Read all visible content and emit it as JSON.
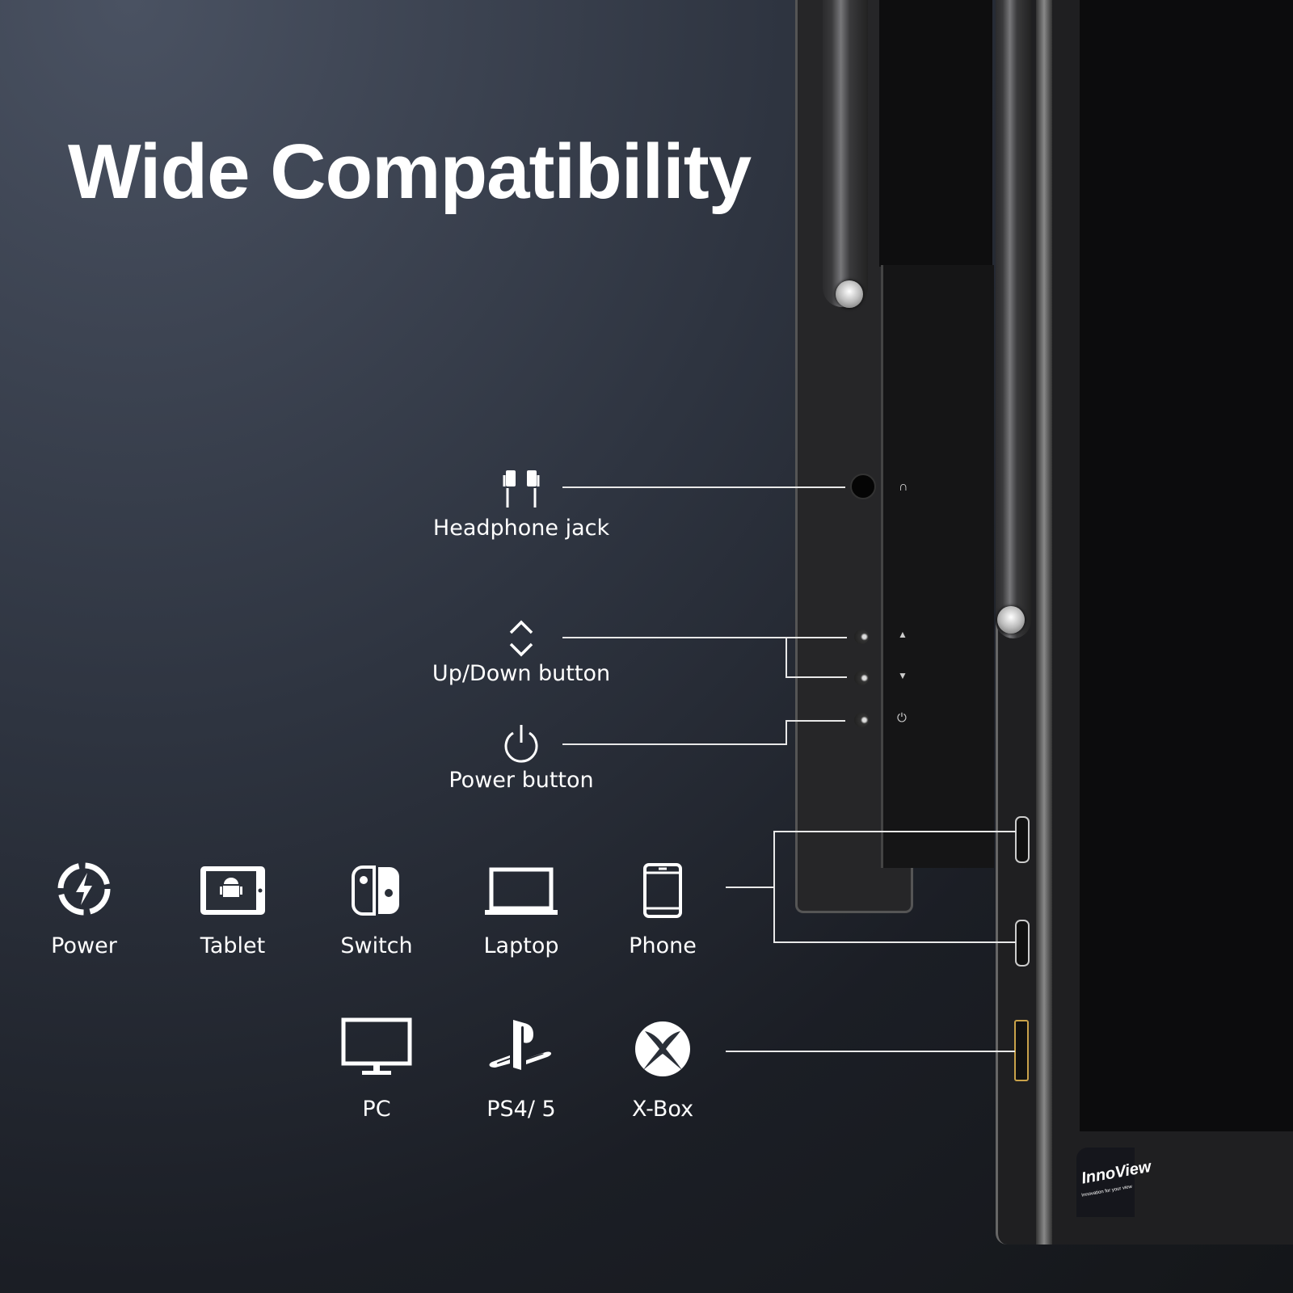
{
  "title": "Wide Compatibility",
  "callouts": {
    "headphone": "Headphone jack",
    "updown": "Up/Down button",
    "power": "Power button"
  },
  "devices_row1": [
    {
      "label": "Power",
      "icon": "power-bolt-icon"
    },
    {
      "label": "Tablet",
      "icon": "tablet-icon"
    },
    {
      "label": "Switch",
      "icon": "switch-icon"
    },
    {
      "label": "Laptop",
      "icon": "laptop-icon"
    },
    {
      "label": "Phone",
      "icon": "phone-icon"
    }
  ],
  "devices_row2": [
    {
      "label": "PC",
      "icon": "monitor-icon"
    },
    {
      "label": "PS4/ 5",
      "icon": "playstation-icon"
    },
    {
      "label": "X-Box",
      "icon": "xbox-icon"
    }
  ],
  "brand": {
    "name": "InnoView",
    "tagline": "Innovation for your view"
  }
}
